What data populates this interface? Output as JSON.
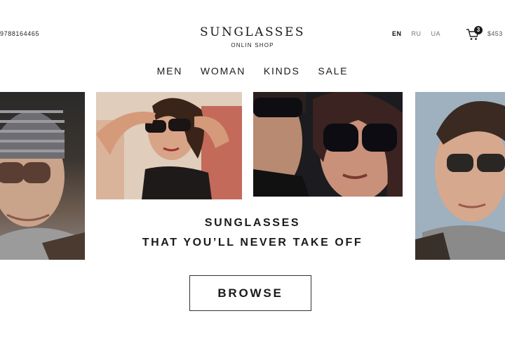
{
  "header": {
    "phone": "9788164465",
    "brand_title": "SUNGLASSES",
    "brand_subtitle": "ONLIN SHOP",
    "languages": [
      "EN",
      "RU",
      "UA"
    ],
    "active_language": "EN",
    "cart_count": "3",
    "cart_total": "$453"
  },
  "nav": {
    "items": [
      "MEN",
      "WOMAN",
      "KINDS",
      "SALE"
    ]
  },
  "hero": {
    "tagline_line1": "SUNGLASSES",
    "tagline_line2": "THAT YOU’LL NEVER TAKE OFF",
    "cta_label": "BROWSE"
  },
  "icons": {
    "cart": "cart-icon"
  },
  "colors": {
    "text": "#1a1a1a",
    "background": "#ffffff"
  }
}
